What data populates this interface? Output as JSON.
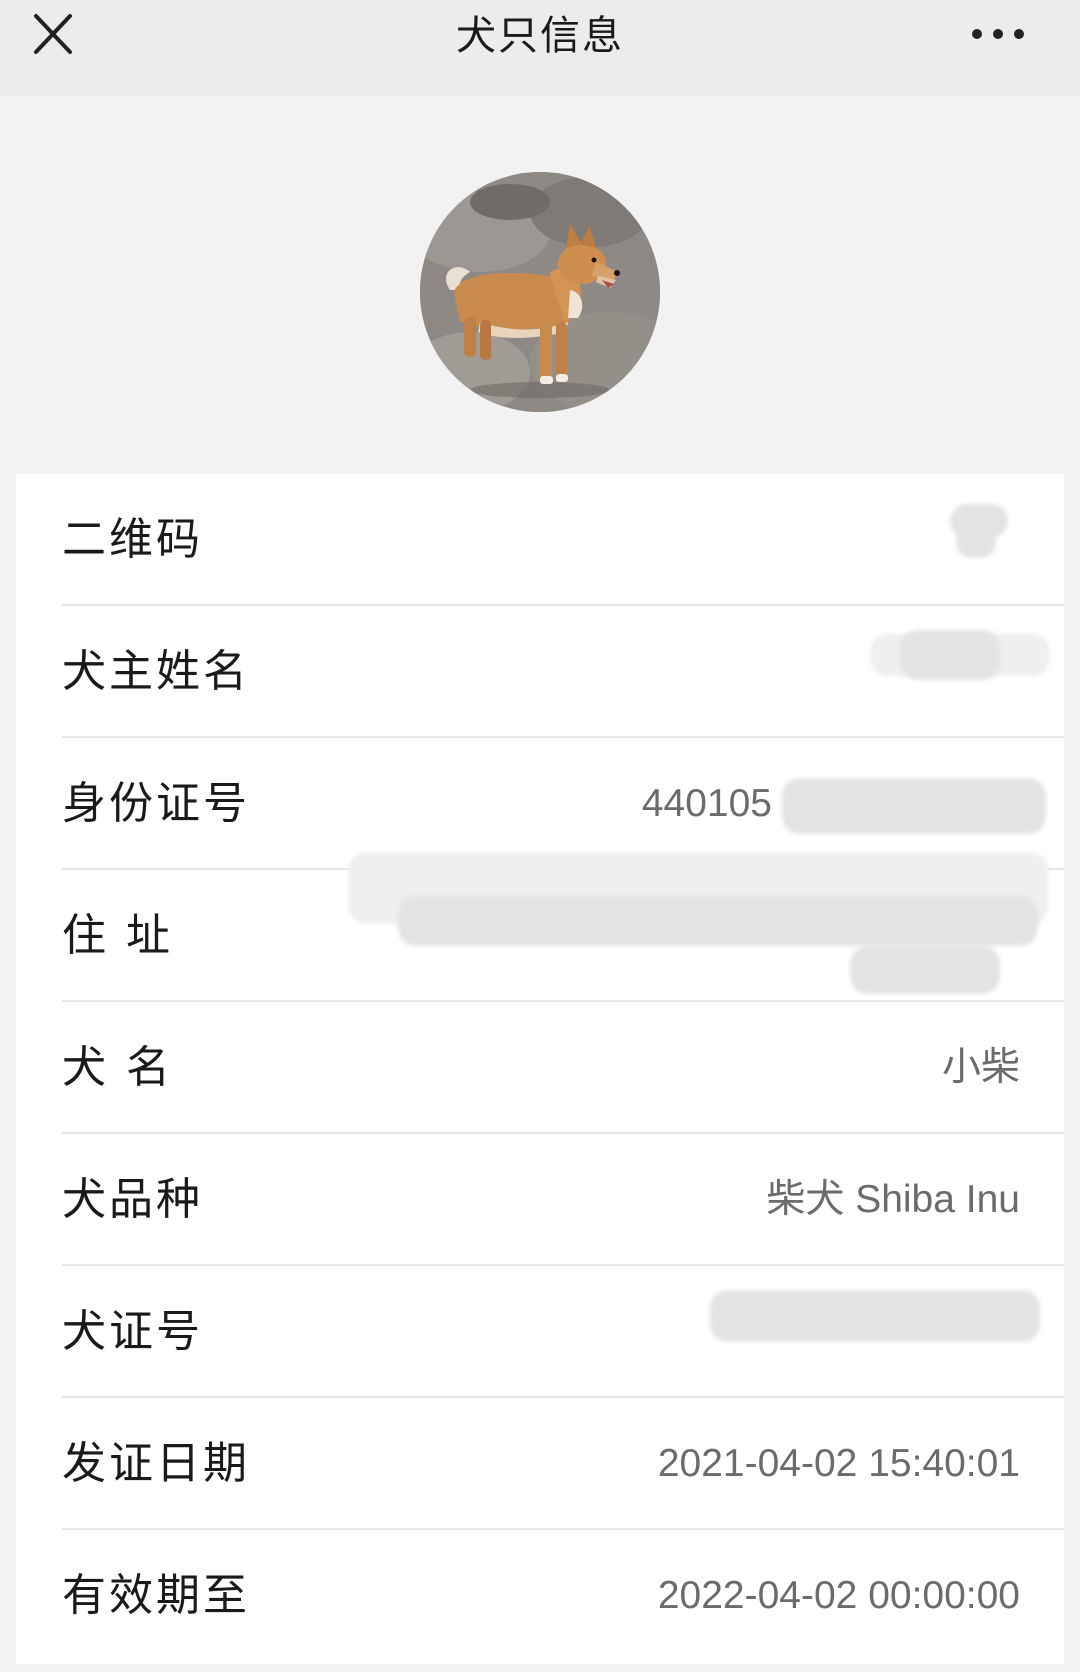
{
  "navbar": {
    "title": "犬只信息",
    "close_icon": "close-icon",
    "more_icon": "more-dots-icon"
  },
  "avatar": {
    "alt": "dog-photo"
  },
  "fields": [
    {
      "label": "二维码",
      "value": ""
    },
    {
      "label": "犬主姓名",
      "value": ""
    },
    {
      "label": "身份证号",
      "value": "440105"
    },
    {
      "label": "住 址",
      "value": ""
    },
    {
      "label": "犬 名",
      "value": "小柴"
    },
    {
      "label": "犬品种",
      "value": "柴犬 Shiba Inu"
    },
    {
      "label": "犬证号",
      "value": ""
    },
    {
      "label": "发证日期",
      "value": "2021-04-02 15:40:01"
    },
    {
      "label": "有效期至",
      "value": "2022-04-02 00:00:00"
    }
  ],
  "colors": {
    "background": "#f2f2f2",
    "navbar": "#ececec",
    "card": "#ffffff",
    "label": "#1a1a1a",
    "value": "#6b6b6b",
    "divider": "#e6e6e6"
  }
}
